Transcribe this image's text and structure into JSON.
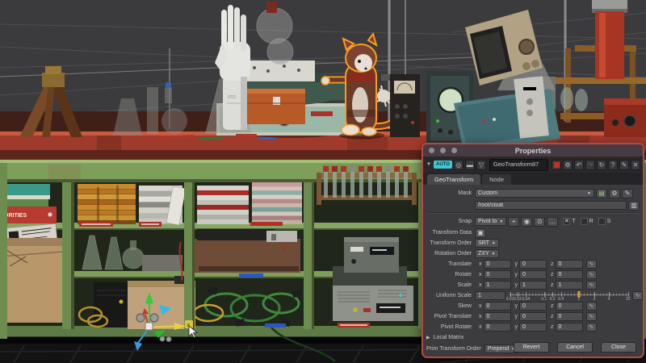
{
  "colors": {
    "accent_red": "#b5493f",
    "badge_cyan": "#3fc6d6",
    "slider_handle": "#e8a030",
    "selection_outline": "#ff9a20",
    "cabinet_green": "#7e9e5c",
    "bench_red": "#a03a2c"
  },
  "icons": {
    "caret_down": "▼",
    "dropdown_arrow": "▾",
    "presets": "◎",
    "compare": "▬",
    "filter": "▽",
    "gear": "⚙",
    "undo": "↶",
    "redo": "↷",
    "refresh": "↻",
    "help": "?",
    "pin": "✎",
    "close": "✕",
    "folder": "▤",
    "pencil": "✎",
    "page": "▥",
    "layers": "▣",
    "snap_target": "⌖",
    "snap_circle": "◉",
    "snap_dot": "⊙",
    "more": "…",
    "curve": "∿",
    "collapsed_tri": "▶"
  },
  "viewport": {
    "scene_labels": {
      "red_box_text": "ORITIES",
      "glove_text": "STD"
    },
    "gizmo": {
      "axis_label": "x"
    }
  },
  "panel": {
    "title": "Properties",
    "header": {
      "auto_badge": "AUTO",
      "name": "GeoTransform87"
    },
    "tabs": [
      {
        "label": "GeoTransform"
      },
      {
        "label": "Node"
      }
    ],
    "mask": {
      "label": "Mask",
      "value": "Custom",
      "path": "/root/stoat"
    },
    "snap": {
      "label": "Snap",
      "mode": "Pivot to",
      "toggles": [
        {
          "label": "T",
          "mark": "✕"
        },
        {
          "label": "R",
          "mark": ""
        },
        {
          "label": "S",
          "mark": ""
        }
      ]
    },
    "transform_data_label": "Transform Data",
    "transform_order": {
      "label": "Transform Order",
      "value": "SRT"
    },
    "rotation_order": {
      "label": "Rotation Order",
      "value": "ZXY"
    },
    "axis_labels": {
      "x": "x",
      "y": "y",
      "z": "z"
    },
    "xyz_rows": [
      {
        "label": "Translate",
        "x": "0",
        "y": "0",
        "z": "0"
      },
      {
        "label": "Rotate",
        "x": "0",
        "y": "0",
        "z": "0"
      },
      {
        "label": "Scale",
        "x": "1",
        "y": "1",
        "z": "1"
      },
      {
        "label": "Skew",
        "x": "0",
        "y": "0",
        "z": "0"
      },
      {
        "label": "Pivot Translate",
        "x": "0",
        "y": "0",
        "z": "0"
      },
      {
        "label": "Pivot Rotate",
        "x": "0",
        "y": "0",
        "z": "0"
      }
    ],
    "uniform_scale": {
      "label": "Uniform Scale",
      "value": "1",
      "ticks": [
        "0.01",
        "0.02",
        "0.04",
        "0.1",
        "0.2",
        "0.4",
        "1",
        "2",
        "4",
        "10"
      ],
      "handle_tick_index": 6
    },
    "local_matrix_label": "Local Matrix",
    "prim_transform_order": {
      "label": "Prim Transform Order",
      "value": "Prepend"
    },
    "footer_buttons": [
      "Revert",
      "Cancel",
      "Close"
    ]
  }
}
